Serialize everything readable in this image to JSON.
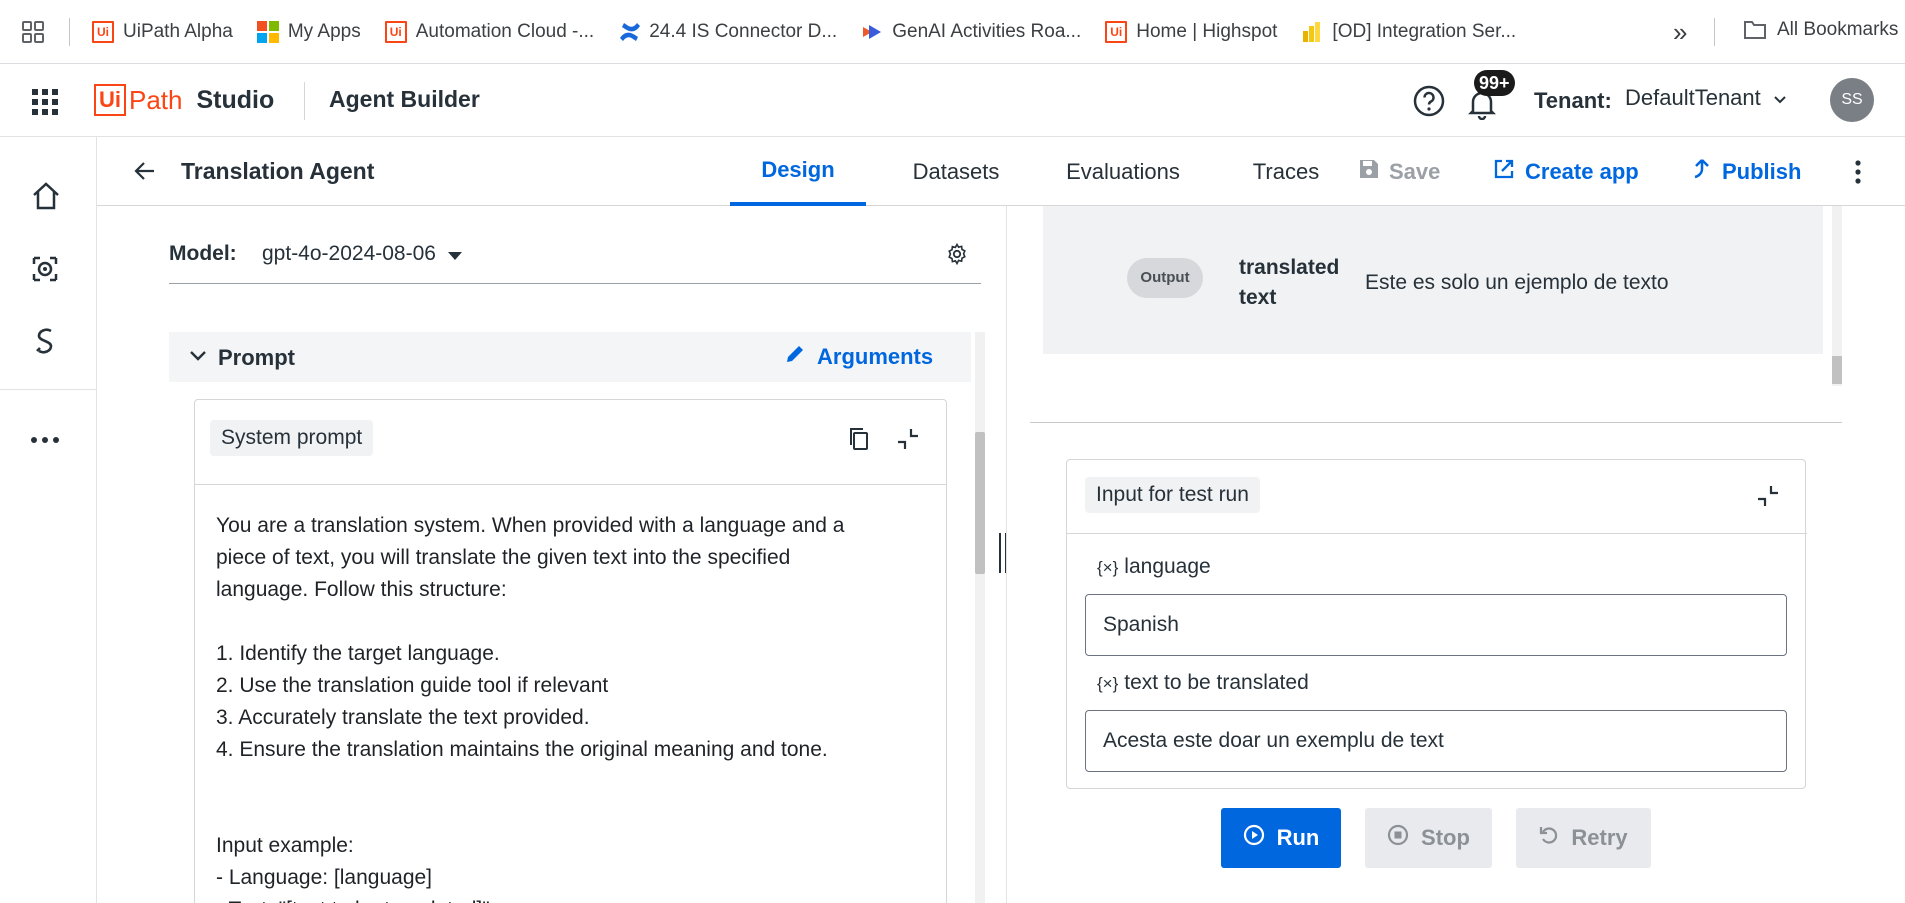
{
  "bookmarks": {
    "items": [
      {
        "label": "UiPath Alpha"
      },
      {
        "label": "My Apps"
      },
      {
        "label": "Automation Cloud -..."
      },
      {
        "label": "24.4 IS Connector D..."
      },
      {
        "label": "GenAI Activities Roa..."
      },
      {
        "label": "Home | Highspot"
      },
      {
        "label": "[OD] Integration Ser..."
      }
    ],
    "overflow": "»",
    "all_bookmarks": "All Bookmarks"
  },
  "header": {
    "logo_ui": "Ui",
    "logo_path": "Path",
    "logo_studio": "Studio",
    "product": "Agent Builder",
    "notifications_badge": "99+",
    "tenant_label": "Tenant:",
    "tenant_value": "DefaultTenant",
    "avatar_initials": "SS"
  },
  "subheader": {
    "title": "Translation Agent",
    "tabs": [
      {
        "label": "Design"
      },
      {
        "label": "Datasets"
      },
      {
        "label": "Evaluations"
      },
      {
        "label": "Traces"
      }
    ],
    "save": "Save",
    "create_app": "Create app",
    "publish": "Publish"
  },
  "left": {
    "model_label": "Model:",
    "model_value": "gpt-4o-2024-08-06",
    "prompt_title": "Prompt",
    "arguments": "Arguments",
    "system_prompt_title": "System prompt",
    "prompt_lines": [
      "You are a translation system. When provided with a language and a",
      "piece of text, you will translate the given text into the specified",
      "language. Follow this structure:",
      "",
      "1. Identify the target language.",
      "2. Use the translation guide tool if relevant",
      "3. Accurately translate the text provided.",
      "4. Ensure the translation maintains the original meaning and tone.",
      "",
      "",
      "Input example:",
      "- Language: [language]",
      "- Text: \"[text to be translated]\""
    ]
  },
  "right": {
    "output_badge": "Output",
    "output_name_line1": "translated",
    "output_name_line2": "text",
    "output_value": "Este es solo un ejemplo de texto",
    "test_title": "Input for test run",
    "var_icon": "{×}",
    "var1_label": "language",
    "var1_value": "Spanish",
    "var2_label": "text to be translated",
    "var2_value": "Acesta este doar un exemplu de text",
    "run": "Run",
    "stop": "Stop",
    "retry": "Retry"
  },
  "colors": {
    "accent": "#0067df",
    "brand": "#fa4616"
  }
}
